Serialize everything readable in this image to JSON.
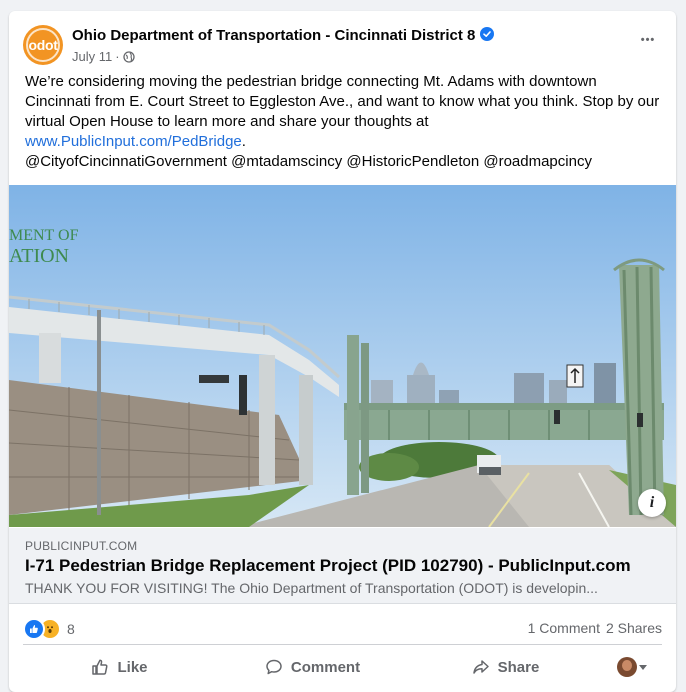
{
  "post": {
    "page_name": "Ohio Department of Transportation - Cincinnati District 8",
    "avatar_text": "odot",
    "date": "July 11",
    "separator": "·",
    "more_label": "•••",
    "body_line1": "We’re considering moving the pedestrian bridge connecting Mt. Adams with downtown Cincinnati from E. Court Street to Eggleston Ave., and want to know what you think. Stop by our virtual Open House to learn more and share your thoughts at",
    "link_text": "www.PublicInput.com/PedBridge",
    "link_suffix": ".",
    "mentions": "@CityofCincinnatiGovernment @mtadamscincy @HistoricPendleton @roadmapcincy"
  },
  "image": {
    "sign_line1": "MENT OF",
    "sign_line2": "ATION",
    "info_label": "i"
  },
  "link_preview": {
    "domain": "PUBLICINPUT.COM",
    "title": "I-71 Pedestrian Bridge Replacement Project (PID 102790) - PublicInput.com",
    "description": "THANK YOU FOR VISITING! The Ohio Department of Transportation (ODOT) is developin..."
  },
  "stats": {
    "reactions_count": "8",
    "comments": "1 Comment",
    "shares": "2 Shares"
  },
  "actions": {
    "like": "Like",
    "comment": "Comment",
    "share": "Share"
  },
  "colors": {
    "accent": "#1877f2",
    "link": "#216fdb",
    "odot_orange": "#f29423"
  }
}
